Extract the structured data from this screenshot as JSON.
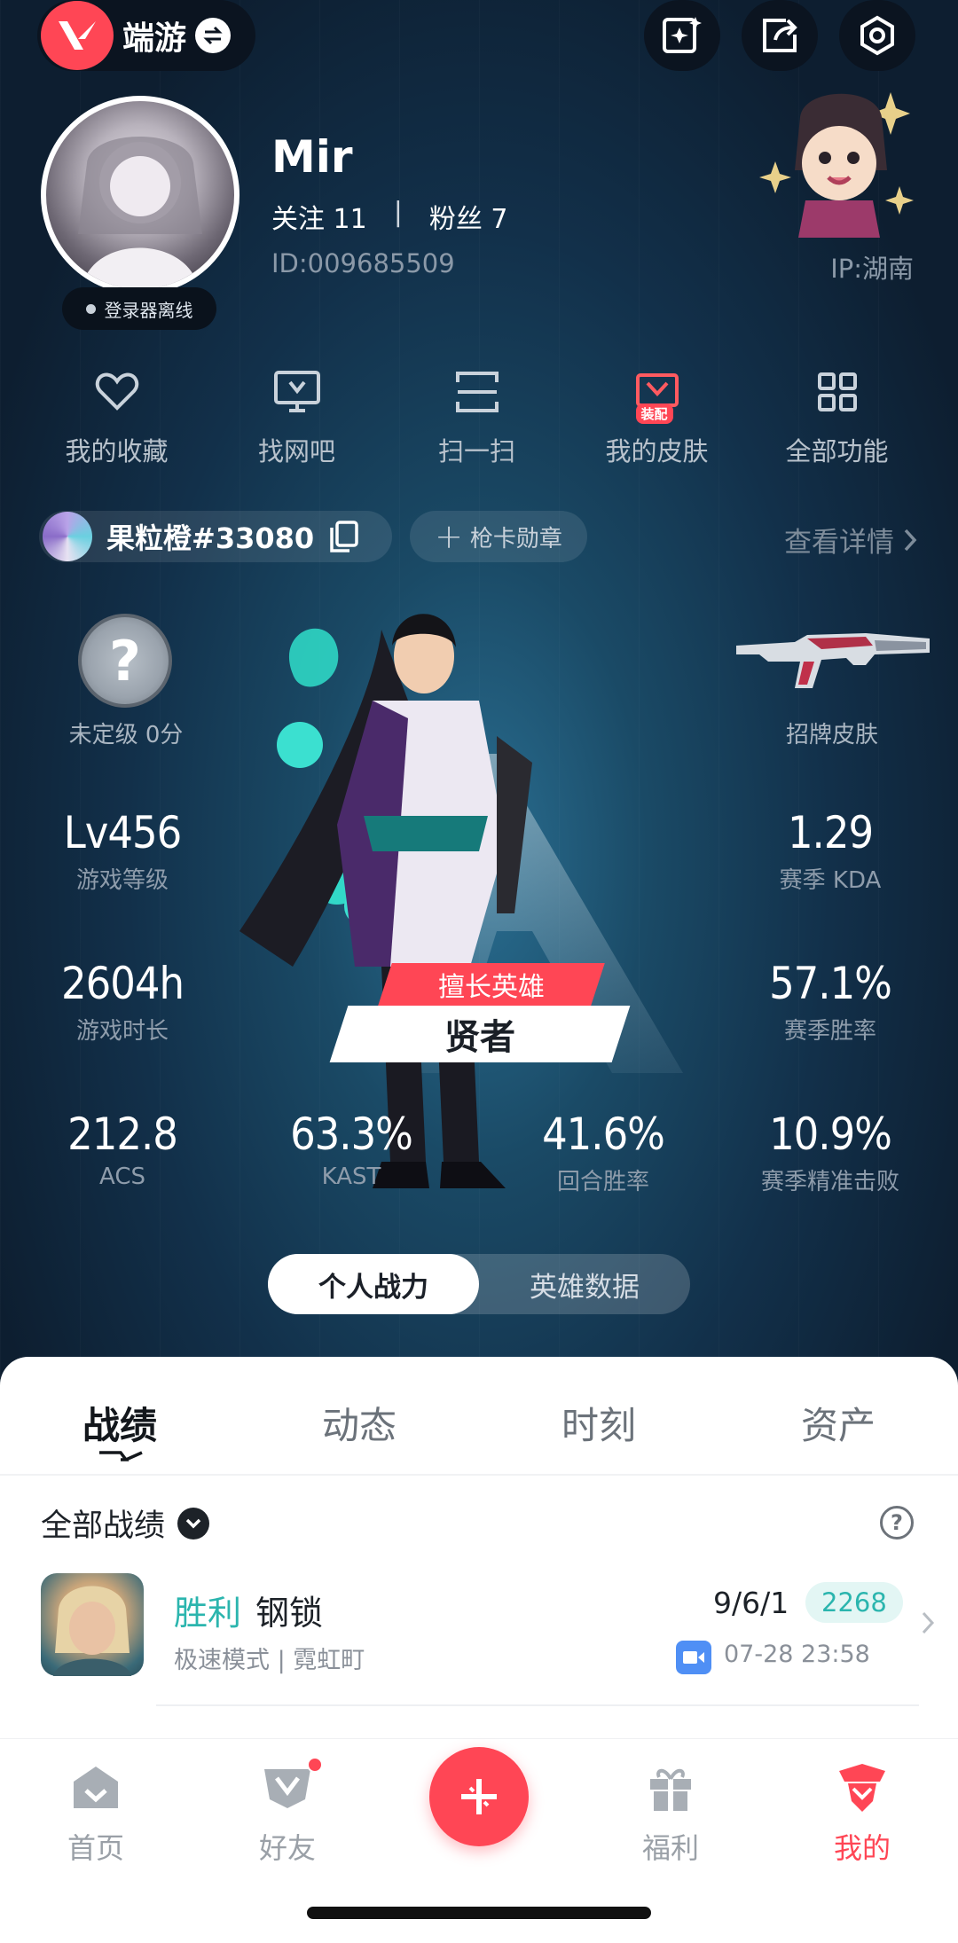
{
  "topbar": {
    "brand": "端游"
  },
  "profile": {
    "username": "Mir",
    "following_label": "关注",
    "following_count": "11",
    "separator": "|",
    "fans_label": "粉丝",
    "fans_count": "7",
    "id_text": "ID:009685509",
    "ip_text": "IP:湖南",
    "status": "登录器离线"
  },
  "shortcuts": [
    {
      "label": "我的收藏",
      "icon": "heart-icon"
    },
    {
      "label": "找网吧",
      "icon": "monitor-icon"
    },
    {
      "label": "扫一扫",
      "icon": "scan-icon"
    },
    {
      "label": "我的皮肤",
      "icon": "skin-icon",
      "badge": "装配"
    },
    {
      "label": "全部功能",
      "icon": "grid-icon"
    }
  ],
  "account": {
    "name": "果粒橙#33080",
    "badge_button": "枪卡勋章",
    "detail_link": "查看详情"
  },
  "rank": {
    "label": "未定级 0分",
    "icon_text": "?"
  },
  "signature_skin": {
    "label": "招牌皮肤"
  },
  "stats": {
    "level": {
      "value": "Lv456",
      "label": "游戏等级"
    },
    "hours": {
      "value": "2604h",
      "label": "游戏时长"
    },
    "kda": {
      "value": "1.29",
      "label": "赛季 KDA"
    },
    "winrate": {
      "value": "57.1%",
      "label": "赛季胜率"
    },
    "acs": {
      "value": "212.8",
      "label": "ACS"
    },
    "kast": {
      "value": "63.3%",
      "label": "KAST"
    },
    "round_win": {
      "value": "41.6%",
      "label": "回合胜率"
    },
    "precision": {
      "value": "10.9%",
      "label": "赛季精准击败"
    }
  },
  "best_agent": {
    "tag": "擅长英雄",
    "name": "贤者"
  },
  "segment": {
    "left": "个人战力",
    "right": "英雄数据"
  },
  "tabs": [
    "战绩",
    "动态",
    "时刻",
    "资产"
  ],
  "filter": {
    "label": "全部战绩"
  },
  "match": {
    "result": "胜利",
    "agent": "钢锁",
    "mode": "极速模式 | 霓虹町",
    "kda": "9/6/1",
    "score": "2268",
    "time": "07-28 23:58"
  },
  "nav": {
    "home": "首页",
    "friends": "好友",
    "welfare": "福利",
    "mine": "我的"
  },
  "colors": {
    "accent": "#ff4655",
    "win": "#2bb5ae"
  }
}
